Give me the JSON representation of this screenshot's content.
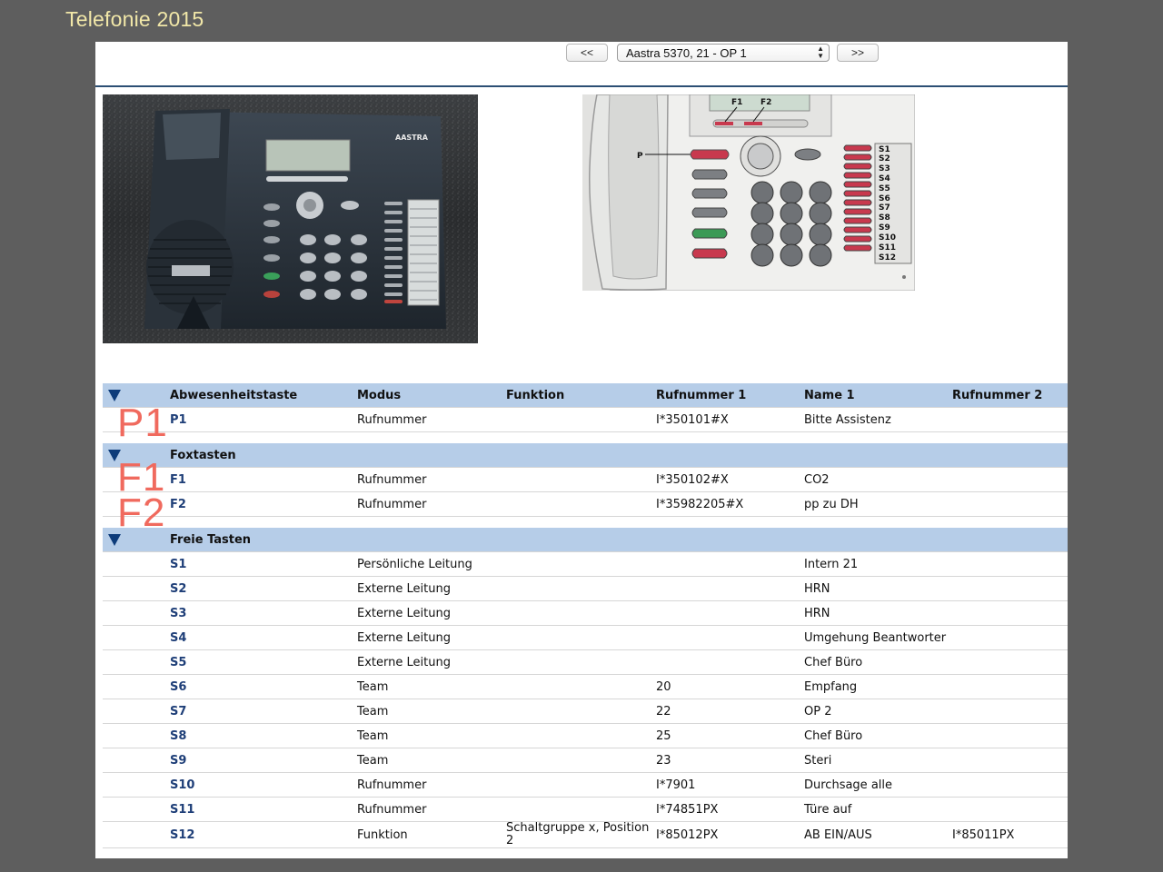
{
  "slide": {
    "title": "Telefonie 2015"
  },
  "nav": {
    "prev_label": "<<",
    "next_label": ">>",
    "selected": "Aastra 5370, 21 - OP 1"
  },
  "diagram": {
    "labels": [
      "F1",
      "F2",
      "P",
      "S1",
      "S2",
      "S3",
      "S4",
      "S5",
      "S6",
      "S7",
      "S8",
      "S9",
      "S10",
      "S11",
      "S12"
    ],
    "photo_brand": "AASTRA"
  },
  "table": {
    "groups": [
      {
        "label": "Abwesenheitstaste",
        "headers": [
          "Modus",
          "Funktion",
          "Rufnummer 1",
          "Name 1",
          "Rufnummer 2"
        ],
        "rows": [
          {
            "key": "P1",
            "modus": "Rufnummer",
            "funktion": "",
            "rufnummer1": "I*350101#X",
            "name1": "Bitte Assistenz",
            "rufnummer2": ""
          }
        ]
      },
      {
        "label": "Foxtasten",
        "rows": [
          {
            "key": "F1",
            "modus": "Rufnummer",
            "funktion": "",
            "rufnummer1": "I*350102#X",
            "name1": "CO2",
            "rufnummer2": ""
          },
          {
            "key": "F2",
            "modus": "Rufnummer",
            "funktion": "",
            "rufnummer1": "I*35982205#X",
            "name1": "pp zu DH",
            "rufnummer2": ""
          }
        ]
      },
      {
        "label": "Freie Tasten",
        "rows": [
          {
            "key": "S1",
            "modus": "Persönliche Leitung",
            "funktion": "",
            "rufnummer1": "",
            "name1": "Intern 21",
            "rufnummer2": ""
          },
          {
            "key": "S2",
            "modus": "Externe Leitung",
            "funktion": "",
            "rufnummer1": "",
            "name1": "HRN",
            "rufnummer2": ""
          },
          {
            "key": "S3",
            "modus": "Externe Leitung",
            "funktion": "",
            "rufnummer1": "",
            "name1": "HRN",
            "rufnummer2": ""
          },
          {
            "key": "S4",
            "modus": "Externe Leitung",
            "funktion": "",
            "rufnummer1": "",
            "name1": "Umgehung Beantworter",
            "rufnummer2": ""
          },
          {
            "key": "S5",
            "modus": "Externe Leitung",
            "funktion": "",
            "rufnummer1": "",
            "name1": "Chef Büro",
            "rufnummer2": ""
          },
          {
            "key": "S6",
            "modus": "Team",
            "funktion": "",
            "rufnummer1": "20",
            "name1": "Empfang",
            "rufnummer2": ""
          },
          {
            "key": "S7",
            "modus": "Team",
            "funktion": "",
            "rufnummer1": "22",
            "name1": "OP 2",
            "rufnummer2": ""
          },
          {
            "key": "S8",
            "modus": "Team",
            "funktion": "",
            "rufnummer1": "25",
            "name1": "Chef Büro",
            "rufnummer2": ""
          },
          {
            "key": "S9",
            "modus": "Team",
            "funktion": "",
            "rufnummer1": "23",
            "name1": "Steri",
            "rufnummer2": ""
          },
          {
            "key": "S10",
            "modus": "Rufnummer",
            "funktion": "",
            "rufnummer1": "I*7901",
            "name1": "Durchsage alle",
            "rufnummer2": ""
          },
          {
            "key": "S11",
            "modus": "Rufnummer",
            "funktion": "",
            "rufnummer1": "I*74851PX",
            "name1": "Türe auf",
            "rufnummer2": ""
          },
          {
            "key": "S12",
            "modus": "Funktion",
            "funktion": "Schaltgruppe x, Position 2",
            "rufnummer1": "I*85012PX",
            "name1": "AB EIN/AUS",
            "rufnummer2": "I*85011PX"
          }
        ]
      }
    ]
  },
  "overlays": {
    "p1": "P1",
    "f1": "F1",
    "f2": "F2"
  },
  "colors": {
    "background": "#5e5e5e",
    "header_band": "#b6cde8",
    "title": "#f1e7a8",
    "overlay": "#f06a5e",
    "key_text": "#1f3f78"
  }
}
